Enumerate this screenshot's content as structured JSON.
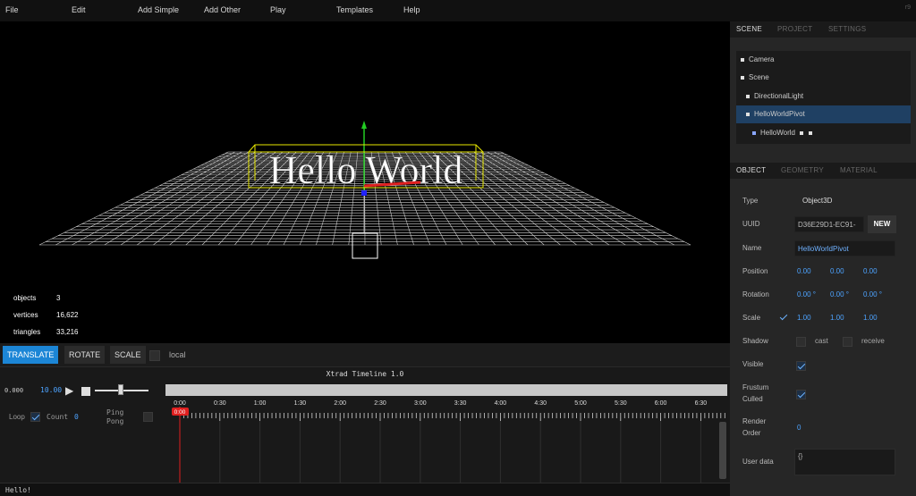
{
  "menubar": {
    "items": [
      "File",
      "Edit",
      "Add Simple",
      "Add Other",
      "Play",
      "Templates",
      "Help"
    ],
    "revision": "r9"
  },
  "viewport": {
    "text_object": "Hello World",
    "info": [
      {
        "label": "objects",
        "value": "3"
      },
      {
        "label": "vertices",
        "value": "16,622"
      },
      {
        "label": "triangles",
        "value": "33,216"
      }
    ]
  },
  "toolbar": {
    "translate": "TRANSLATE",
    "rotate": "ROTATE",
    "scale": "SCALE",
    "local": "local"
  },
  "timeline": {
    "title": "Xtrad Timeline 1.0",
    "current_time": "0.000",
    "duration": "10.00",
    "loop_label": "Loop",
    "count_label": "Count",
    "count_value": "0",
    "ping_label": "Ping",
    "pong_label": "Pong",
    "ticks": [
      "0:00",
      "0:30",
      "1:00",
      "1:30",
      "2:00",
      "2:30",
      "3:00",
      "3:30",
      "4:00",
      "4:30",
      "5:00",
      "5:30",
      "6:00",
      "6:30"
    ],
    "playhead_label": "0:00"
  },
  "status": {
    "text": "Hello!"
  },
  "sidebar": {
    "top_tabs": [
      "SCENE",
      "PROJECT",
      "SETTINGS"
    ],
    "outliner": [
      {
        "label": "Camera",
        "selected": false
      },
      {
        "label": "Scene",
        "selected": false
      },
      {
        "label": "DirectionalLight",
        "selected": false
      },
      {
        "label": "HelloWorldPivot",
        "selected": true
      },
      {
        "label": "HelloWorld",
        "selected": false
      }
    ],
    "prop_tabs": [
      "OBJECT",
      "GEOMETRY",
      "MATERIAL"
    ],
    "props": {
      "type_label": "Type",
      "type_value": "Object3D",
      "uuid_label": "UUID",
      "uuid_value": "D36E29D1-EC91-",
      "new_button": "NEW",
      "name_label": "Name",
      "name_value": "HelloWorldPivot",
      "position_label": "Position",
      "position": [
        "0.00",
        "0.00",
        "0.00"
      ],
      "rotation_label": "Rotation",
      "rotation": [
        "0.00 °",
        "0.00 °",
        "0.00 °"
      ],
      "scale_label": "Scale",
      "scale": [
        "1.00",
        "1.00",
        "1.00"
      ],
      "shadow_label": "Shadow",
      "cast_label": "cast",
      "receive_label": "receive",
      "visible_label": "Visible",
      "frustum_label_1": "Frustum",
      "frustum_label_2": "Culled",
      "render_label_1": "Render",
      "render_label_2": "Order",
      "render_value": "0",
      "userdata_label": "User data",
      "userdata_value": "{}"
    }
  },
  "colors": {
    "accent": "#1c86d6",
    "number": "#4da3ff",
    "selection": "#1f4063",
    "playhead": "#e02020"
  }
}
